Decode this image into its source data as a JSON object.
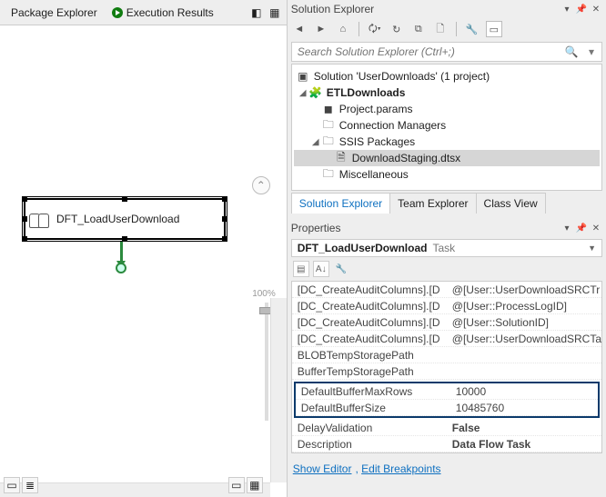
{
  "left": {
    "tabs": {
      "package_explorer": "Package Explorer",
      "execution_results": "Execution Results"
    },
    "task_label": "DFT_LoadUserDownload",
    "zoom": "100%"
  },
  "solution_explorer": {
    "title": "Solution Explorer",
    "search_placeholder": "Search Solution Explorer (Ctrl+;)",
    "tree": {
      "root": "Solution 'UserDownloads' (1 project)",
      "project": "ETLDownloads",
      "items": [
        "Project.params",
        "Connection Managers",
        "SSIS Packages",
        "Miscellaneous"
      ],
      "package": "DownloadStaging.dtsx"
    },
    "tabs": {
      "solution": "Solution Explorer",
      "team": "Team Explorer",
      "class": "Class View"
    }
  },
  "properties": {
    "title": "Properties",
    "target_name": "DFT_LoadUserDownload",
    "target_type": "Task",
    "rows": [
      {
        "k": "[DC_CreateAuditColumns].[D",
        "v": "@[User::UserDownloadSRCTr"
      },
      {
        "k": "[DC_CreateAuditColumns].[D",
        "v": "@[User::ProcessLogID]"
      },
      {
        "k": "[DC_CreateAuditColumns].[D",
        "v": "@[User::SolutionID]"
      },
      {
        "k": "[DC_CreateAuditColumns].[D",
        "v": "@[User::UserDownloadSRCTa"
      },
      {
        "k": "BLOBTempStoragePath",
        "v": ""
      },
      {
        "k": "BufferTempStoragePath",
        "v": ""
      }
    ],
    "highlighted": [
      {
        "k": "DefaultBufferMaxRows",
        "v": "10000"
      },
      {
        "k": "DefaultBufferSize",
        "v": "10485760"
      }
    ],
    "tail": [
      {
        "k": "DelayValidation",
        "v": "False",
        "bold": true
      },
      {
        "k": "Description",
        "v": "Data Flow Task",
        "bold": true
      }
    ],
    "links": {
      "show_editor": "Show Editor",
      "edit_breakpoints": "Edit Breakpoints"
    }
  }
}
